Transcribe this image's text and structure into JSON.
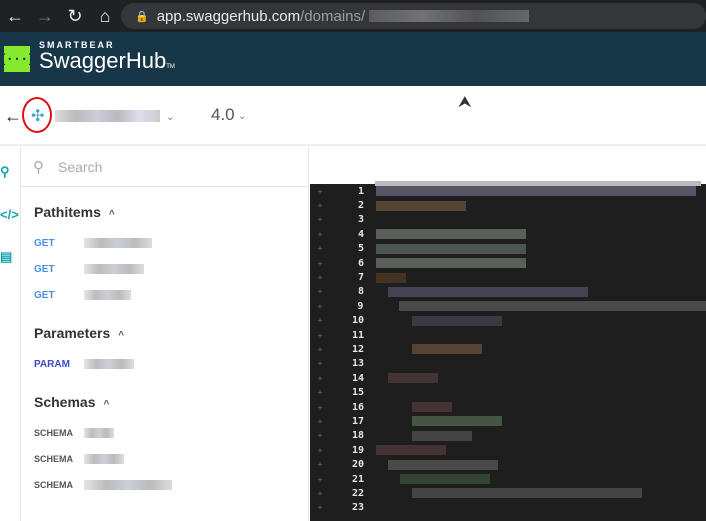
{
  "browser": {
    "url_host": "app.swaggerhub.com",
    "url_path": "/domains/"
  },
  "brand": {
    "company": "SMARTBEAR",
    "product": "SwaggerHub",
    "tm": "TM",
    "logo_glyph": "{···}"
  },
  "header": {
    "version": "4.0"
  },
  "sidebar": {
    "search_placeholder": "Search",
    "sections": [
      {
        "title": "Pathitems",
        "items": [
          {
            "method": "GET"
          },
          {
            "method": "GET"
          },
          {
            "method": "GET"
          }
        ]
      },
      {
        "title": "Parameters",
        "items": [
          {
            "method": "PARAM"
          }
        ]
      },
      {
        "title": "Schemas",
        "items": [
          {
            "method": "SCHEMA"
          },
          {
            "method": "SCHEMA"
          },
          {
            "method": "SCHEMA"
          }
        ]
      }
    ]
  },
  "editor": {
    "line_numbers": [
      "1",
      "2",
      "3",
      "4",
      "5",
      "6",
      "7",
      "8",
      "9",
      "10",
      "11",
      "12",
      "13",
      "14",
      "15",
      "16",
      "17",
      "18",
      "19",
      "20",
      "21",
      "22",
      "23"
    ]
  },
  "colors": {
    "brand_bg": "#173647",
    "logo": "#85ea2d",
    "get": "#4990e2",
    "param": "#3b4bc4",
    "annotation": "#e01010"
  }
}
